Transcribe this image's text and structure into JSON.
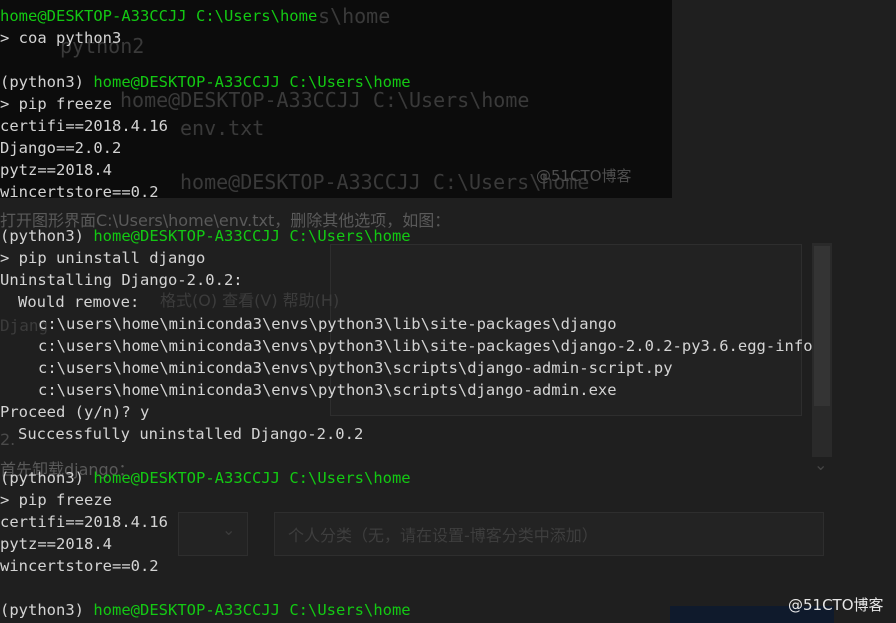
{
  "prompt": {
    "env": "(python3)",
    "user_host": "home@DESKTOP-A33CCJJ",
    "path": "C:\\Users\\home",
    "symbol": ">"
  },
  "lines": {
    "l0_user": "home@DESKTOP-A33CCJJ",
    "l0_path": "C:\\Users\\home",
    "l1_cmd": "> coa python3",
    "l3_cmd": "> pip freeze",
    "l4": "certifi==2018.4.16",
    "l5": "Django==2.0.2",
    "l6": "pytz==2018.4",
    "l7": "wincertstore==0.2",
    "l9_cmd": "> pip uninstall django",
    "l10": "Uninstalling Django-2.0.2:",
    "l11": "Would remove:",
    "l12": "c:\\users\\home\\miniconda3\\envs\\python3\\lib\\site-packages\\django",
    "l13": "c:\\users\\home\\miniconda3\\envs\\python3\\lib\\site-packages\\django-2.0.2-py3.6.egg-info",
    "l14": "c:\\users\\home\\miniconda3\\envs\\python3\\scripts\\django-admin-script.py",
    "l15": "c:\\users\\home\\miniconda3\\envs\\python3\\scripts\\django-admin.exe",
    "l16": "Proceed (y/n)? y",
    "l17": "Successfully uninstalled Django-2.0.2",
    "l19_cmd": "> pip freeze",
    "l20": "certifi==2018.4.16",
    "l21": "pytz==2018.4",
    "l22": "wincertstore==0.2"
  },
  "background": {
    "ghost_users_home": "s\\home",
    "ghost_python2": "python2",
    "ghost_prompt": "home@DESKTOP-A33CCJJ C:\\Users\\home",
    "ghost_env_txt": "env.txt",
    "ghost_prompt2": "home@DESKTOP-A33CCJJ C:\\Users\\home",
    "ghost_instruction": "打开图形界面C:\\Users\\home\\env.txt，删除其他选项，如图：",
    "ghost_menu": "格式(O)   查看(V)   帮助(H)",
    "ghost_django": "Djang",
    "ghost_number": "2.",
    "ghost_uninstall": "首先卸载django：",
    "ghost_category": "个人分类（无，请在设置-博客分类中添加）",
    "ghost_chevron": "⌄"
  },
  "watermarks": {
    "top": "@51CTO博客",
    "bottom": "@51CTO博客"
  },
  "colors": {
    "terminal_bg": "#0c0c0c",
    "text": "#d4d4d4",
    "prompt_green": "#13c913"
  }
}
